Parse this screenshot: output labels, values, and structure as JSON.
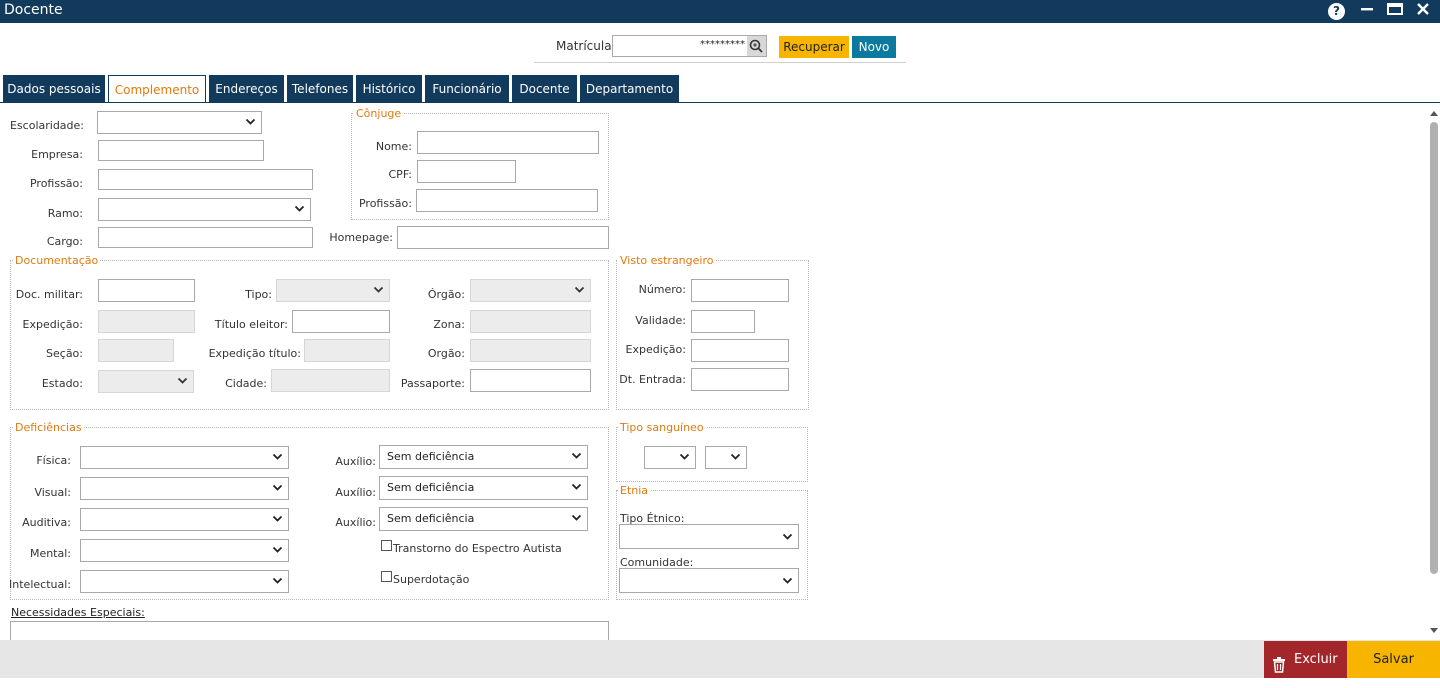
{
  "window": {
    "title": "Docente",
    "help_label": "?",
    "minimize_label": "▬",
    "maximize_label": "▭",
    "close_label": "✕"
  },
  "header": {
    "matricula_label": "Matrícula:",
    "matricula_value": "*********",
    "recuperar_label": "Recuperar",
    "novo_label": "Novo"
  },
  "tabs": [
    {
      "label": "Dados pessoais"
    },
    {
      "label": "Complemento",
      "active": true
    },
    {
      "label": "Endereços"
    },
    {
      "label": "Telefones"
    },
    {
      "label": "Histórico"
    },
    {
      "label": "Funcionário"
    },
    {
      "label": "Docente"
    },
    {
      "label": "Departamento"
    }
  ],
  "complemento": {
    "escolaridade_label": "Escolaridade:",
    "empresa_label": "Empresa:",
    "profissao_label": "Profissão:",
    "ramo_label": "Ramo:",
    "cargo_label": "Cargo:",
    "homepage_label": "Homepage:"
  },
  "conjuge": {
    "legend": "Cônjuge",
    "nome_label": "Nome:",
    "cpf_label": "CPF:",
    "profissao_label": "Profissão:"
  },
  "documentacao": {
    "legend": "Documentação",
    "doc_militar_label": "Doc. militar:",
    "expedicao_label": "Expedição:",
    "secao_label": "Seção:",
    "estado_label": "Estado:",
    "tipo_label": "Tipo:",
    "titulo_eleitor_label": "Título eleitor:",
    "expedicao_titulo_label": "Expedição título:",
    "cidade_label": "Cidade:",
    "orgao_label": "Órgão:",
    "zona_label": "Zona:",
    "orgao2_label": "Orgão:",
    "passaporte_label": "Passaporte:"
  },
  "visto": {
    "legend": "Visto estrangeiro",
    "numero_label": "Número:",
    "validade_label": "Validade:",
    "expedicao_label": "Expedição:",
    "dt_entrada_label": "Dt. Entrada:"
  },
  "deficiencias": {
    "legend": "Deficiências",
    "fisica_label": "Física:",
    "visual_label": "Visual:",
    "auditiva_label": "Auditiva:",
    "mental_label": "Mental:",
    "intelectual_label": "Intelectual:",
    "auxilio_label": "Auxílio:",
    "auxilio_value": "Sem deficiência",
    "tea_label": "Transtorno do Espectro Autista",
    "superdotacao_label": "Superdotação"
  },
  "tipo_sanguineo": {
    "legend": "Tipo sanguíneo"
  },
  "etnia": {
    "legend": "Etnia",
    "tipo_etnico_label": "Tipo Étnico:",
    "comunidade_label": "Comunidade:"
  },
  "necessidades": {
    "label": "Necessidades Especiais:"
  },
  "footer": {
    "excluir_label": "Excluir",
    "salvar_label": "Salvar"
  },
  "icons": {
    "chevron": "⌄",
    "search": "search-icon",
    "trash": "trash-icon"
  },
  "colors": {
    "titlebar": "#123a5c",
    "accent_orange": "#e07a10",
    "recuperar": "#f7b500",
    "novo": "#0b7a9e",
    "excluir": "#a3262b",
    "salvar": "#f7b500"
  }
}
